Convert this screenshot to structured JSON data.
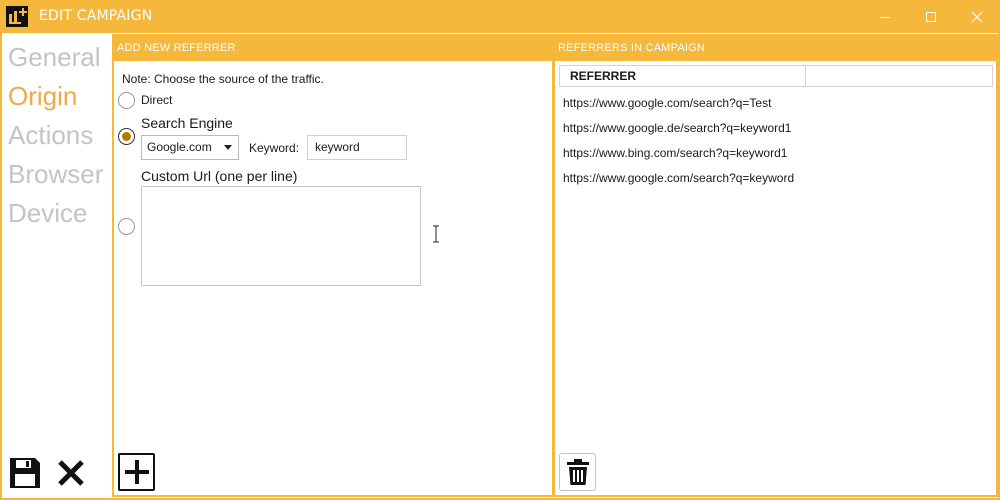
{
  "window": {
    "title": "EDIT CAMPAIGN",
    "accent_color": "#f5b73c",
    "controls": [
      "minimize-icon",
      "maximize-icon",
      "close-icon"
    ]
  },
  "nav": {
    "items": [
      {
        "label": "General",
        "active": false
      },
      {
        "label": "Origin",
        "active": true
      },
      {
        "label": "Actions",
        "active": false
      },
      {
        "label": "Browser",
        "active": false
      },
      {
        "label": "Device",
        "active": false
      }
    ],
    "active_color": "#f0a94a",
    "inactive_color": "#c4c4c4"
  },
  "footer": {
    "save_icon": "save-icon",
    "cancel_icon": "cancel-icon"
  },
  "add_panel": {
    "header": "ADD NEW REFERRER",
    "note": "Note: Choose the source of the traffic.",
    "options": {
      "direct": {
        "label": "Direct",
        "checked": false
      },
      "search_engine": {
        "label": "Search Engine",
        "checked": true
      },
      "custom_url": {
        "label": "Custom Url (one per line)",
        "checked": false
      }
    },
    "engine_select": {
      "value": "Google.com"
    },
    "keyword_label": "Keyword:",
    "keyword_value": "keyword",
    "custom_url_value": "",
    "add_icon": "plus-icon"
  },
  "list_panel": {
    "header": "REFERRERS IN CAMPAIGN",
    "column_header": "REFERRER",
    "rows": [
      "https://www.google.com/search?q=Test",
      "https://www.google.de/search?q=keyword1",
      "https://www.bing.com/search?q=keyword1",
      "https://www.google.com/search?q=keyword"
    ],
    "delete_icon": "trash-icon"
  }
}
